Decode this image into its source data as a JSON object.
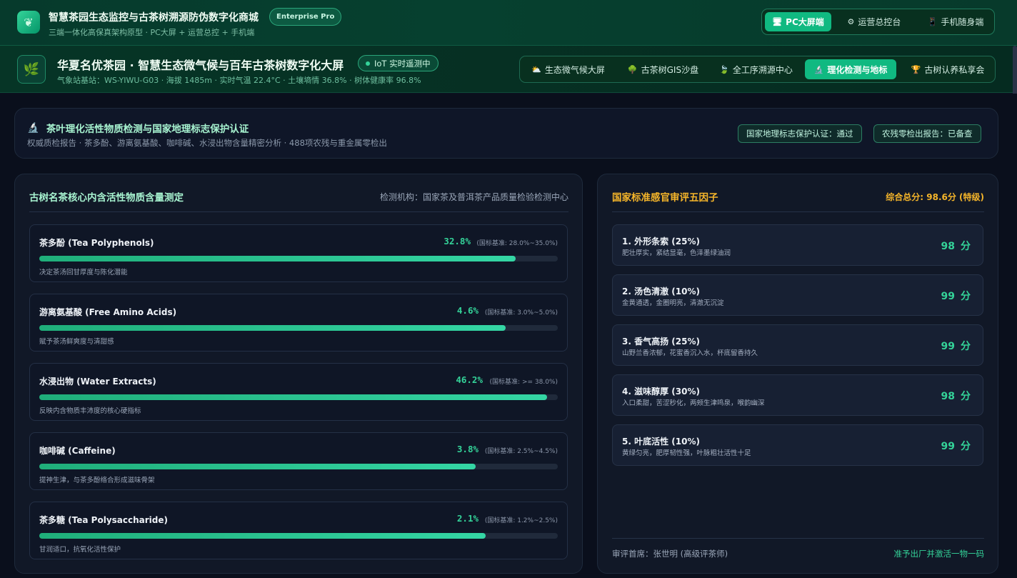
{
  "app": {
    "title": "智慧茶园生态监控与古茶树溯源防伪数字化商城",
    "edition_badge": "Enterprise Pro",
    "subtitle": "三端一体化高保真架构原型 · PC大屏 + 运营总控 + 手机端",
    "modes": [
      {
        "icon": "monitor-icon",
        "glyph": "🖥",
        "label": "PC大屏端",
        "active": true
      },
      {
        "icon": "gear-icon",
        "glyph": "⚙",
        "label": "运营总控台",
        "active": false
      },
      {
        "icon": "phone-icon",
        "glyph": "📱",
        "label": "手机随身端",
        "active": false
      }
    ]
  },
  "site": {
    "logo_glyph": "🌿",
    "title": "华夏名优茶园 · 智慧生态微气候与百年古茶树数字化大屏",
    "iot_badge": "IoT 实时遥测中",
    "station_info": "气象站基站：WS-YIWU-G03 · 海拔 1485m · 实时气温 22.4°C · 土壤墒情 36.8% · 树体健康率 96.8%",
    "tabs": [
      {
        "icon": "sun-cloud-icon",
        "glyph": "⛅",
        "label": "生态微气候大屏",
        "active": false
      },
      {
        "icon": "tree-icon",
        "glyph": "🌳",
        "label": "古茶树GIS沙盘",
        "active": false
      },
      {
        "icon": "leaf-icon",
        "glyph": "🍃",
        "label": "全工序溯源中心",
        "active": false
      },
      {
        "icon": "microscope-icon",
        "glyph": "🔬",
        "label": "理化检测与地标",
        "active": true
      },
      {
        "icon": "trophy-icon",
        "glyph": "🏆",
        "label": "古树认养私享会",
        "active": false
      }
    ]
  },
  "certification": {
    "icon": "microscope-icon",
    "glyph": "🔬",
    "title": "茶叶理化活性物质检测与国家地理标志保护认证",
    "subtitle": "权威质检报告 · 茶多酚、游离氨基酸、咖啡碱、水浸出物含量精密分析 · 488项农残与重金属零检出",
    "badges": [
      "国家地理标志保护认证：通过",
      "农残零检出报告：已备查"
    ]
  },
  "chemistry": {
    "title": "古树名茶核心内含活性物质含量测定",
    "lab": "检测机构：国家茶及普洱茶产品质量检验检测中心",
    "items": [
      {
        "name": "茶多酚 (Tea Polyphenols)",
        "value": "32.8%",
        "standard": "(国标基准: 28.0%~35.0%)",
        "level": 0.919,
        "desc": "决定茶汤回甘厚度与陈化潜能"
      },
      {
        "name": "游离氨基酸 (Free Amino Acids)",
        "value": "4.6%",
        "standard": "(国标基准: 3.0%~5.0%)",
        "level": 0.9,
        "desc": "赋予茶汤鲜爽度与清甜感"
      },
      {
        "name": "水浸出物 (Water Extracts)",
        "value": "46.2%",
        "standard": "(国标基准: >= 38.0%)",
        "level": 0.979,
        "desc": "反映内含物质丰沛度的核心硬指标"
      },
      {
        "name": "咖啡碱 (Caffeine)",
        "value": "3.8%",
        "standard": "(国标基准: 2.5%~4.5%)",
        "level": 0.841,
        "desc": "提神生津，与茶多酚络合形成滋味骨架"
      },
      {
        "name": "茶多糖 (Tea Polysaccharide)",
        "value": "2.1%",
        "standard": "(国标基准: 1.2%~2.5%)",
        "level": 0.861,
        "desc": "甘润适口，抗氧化活性保护"
      }
    ]
  },
  "sensory": {
    "title": "国家标准感官审评五因子",
    "total": "综合总分: 98.6分 (特级)",
    "unit": "分",
    "factors": [
      {
        "name": "1. 外形条索 (25%)",
        "desc": "肥壮厚实，紧结显毫，色泽墨绿油润",
        "score": "98"
      },
      {
        "name": "2. 汤色清澈 (10%)",
        "desc": "金黄通透，金圈明亮，清澈无沉淀",
        "score": "99"
      },
      {
        "name": "3. 香气高扬 (25%)",
        "desc": "山野兰香浓郁，花蜜香沉入水，杯底留香持久",
        "score": "99"
      },
      {
        "name": "4. 滋味醇厚 (30%)",
        "desc": "入口柔甜，苦涩秒化，两颊生津鸣泉，喉韵幽深",
        "score": "98"
      },
      {
        "name": "5. 叶底活性 (10%)",
        "desc": "黄绿匀亮，肥厚韧性强，叶脉粗壮活性十足",
        "score": "99"
      }
    ],
    "chief": "审评首席：张世明 (高级评茶师)",
    "approval": "准予出厂并激活一物一码"
  },
  "colors": {
    "accent": "#10b981",
    "value_green": "#34d399",
    "gold": "#f5b52a"
  }
}
